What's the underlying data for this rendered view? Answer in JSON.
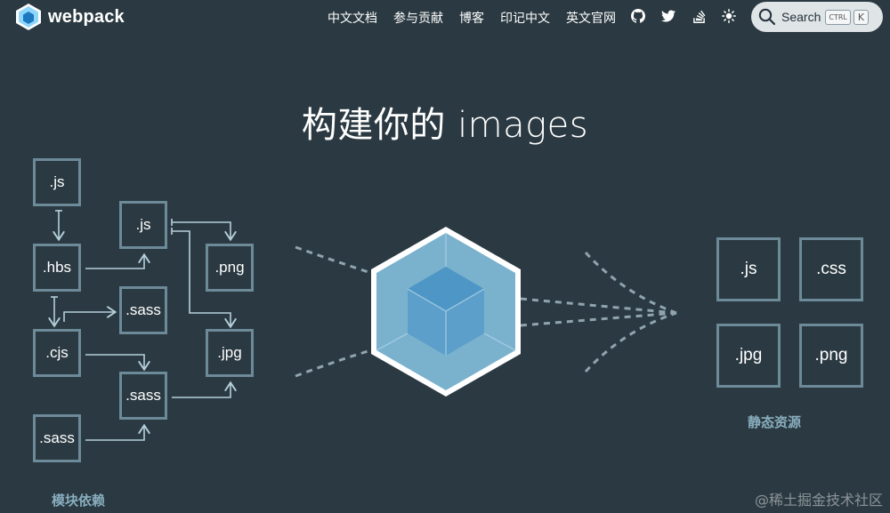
{
  "nav": {
    "logo_text": "webpack",
    "links": [
      "中文文档",
      "参与贡献",
      "博客",
      "印记中文",
      "英文官网"
    ],
    "icons": [
      "github-icon",
      "twitter-icon",
      "stackoverflow-icon",
      "theme-toggle-icon"
    ],
    "search": {
      "label": "Search",
      "shortcut_ctrl": "CTRL",
      "shortcut_key": "K"
    }
  },
  "hero": {
    "title": "构建你的 images"
  },
  "modules": {
    "items": [
      ".js",
      ".hbs",
      ".cjs",
      ".sass",
      ".js",
      ".sass",
      ".sass",
      ".png",
      ".jpg"
    ],
    "caption": "模块依赖"
  },
  "assets": {
    "items": [
      ".js",
      ".css",
      ".jpg",
      ".png"
    ],
    "caption": "静态资源"
  },
  "watermark": "@稀土掘金技术社区",
  "colors": {
    "background": "#2b3a42",
    "box_border": "#6d8a99",
    "caption": "#89aebf",
    "cube_outer": "#8ed6fb",
    "cube_inner": "#1c78c0"
  }
}
